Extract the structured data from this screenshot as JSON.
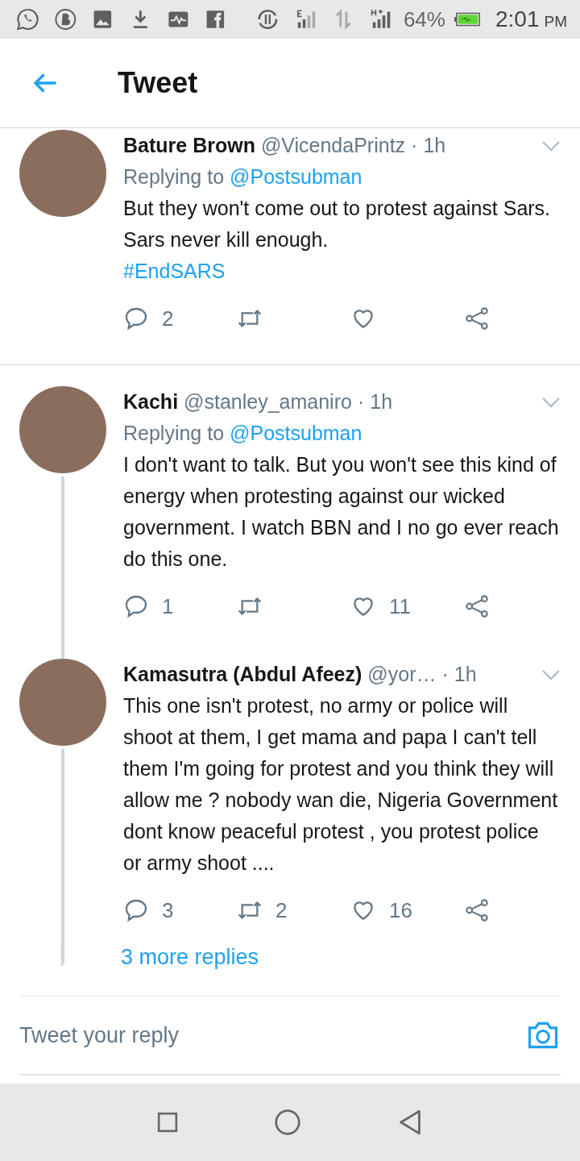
{
  "status_bar": {
    "battery": "64%",
    "time": "2:01",
    "ampm": "PM"
  },
  "header": {
    "title": "Tweet"
  },
  "tweets": [
    {
      "name": "Bature Brown",
      "handle": "@VicendaPrintz",
      "separator": "·",
      "time": "1h",
      "reply_prefix": "Replying to",
      "reply_to": "@Postsubman",
      "text": "But they won't come out to protest against Sars. Sars never kill enough.",
      "link": "#EndSARS",
      "thread_line": false,
      "replies": "2"
    },
    {
      "name": "Kachi",
      "handle": "@stanley_amaniro",
      "separator": "·",
      "time": "1h",
      "reply_prefix": "Replying to",
      "reply_to": "@Postsubman",
      "text": "I don't want to talk. But you won't see this kind of energy when protesting against our wicked government. I watch BBN and I no go ever reach do this one.",
      "thread_line": true,
      "replies": "1",
      "likes": "11"
    },
    {
      "name": "Kamasutra (Abdul Afeez)",
      "handle": "@yor…",
      "separator": "·",
      "time": "1h",
      "text": "This one isn't protest, no army or police will shoot at them, I get mama and papa I can't tell them I'm going for protest and you think they will allow me ? nobody wan die, Nigeria Government dont know peaceful protest , you protest police or army shoot ....",
      "thread_line": true,
      "replies": "3",
      "retweets": "2",
      "likes": "16"
    }
  ],
  "more_replies": "3 more replies",
  "reply_bar": {
    "placeholder": "Tweet your reply"
  }
}
